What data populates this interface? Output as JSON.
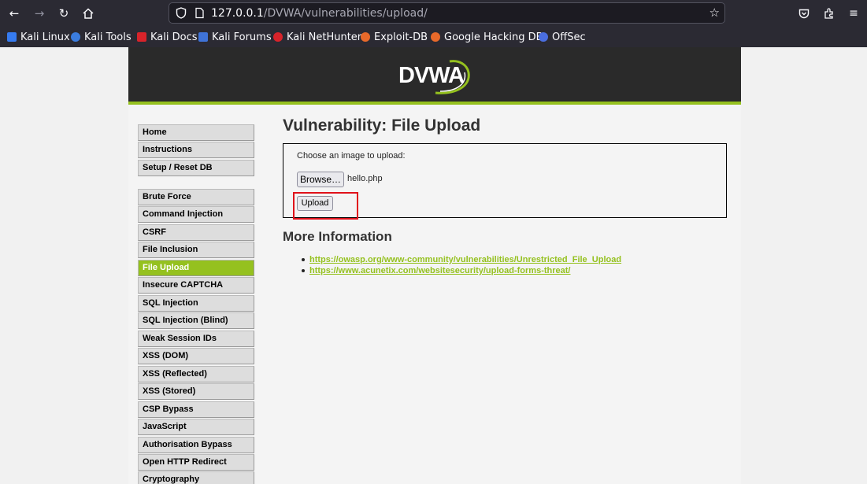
{
  "browser": {
    "url_host": "127.0.0.1",
    "url_path": "/DVWA/vulnerabilities/upload/",
    "bookmarks": [
      {
        "label": "Kali Linux",
        "color": "#367bf0"
      },
      {
        "label": "Kali Tools",
        "color": "#3b7de0"
      },
      {
        "label": "Kali Docs",
        "color": "#d8232a"
      },
      {
        "label": "Kali Forums",
        "color": "#3f73d8"
      },
      {
        "label": "Kali NetHunter",
        "color": "#d8232a"
      },
      {
        "label": "Exploit-DB",
        "color": "#e8692a"
      },
      {
        "label": "Google Hacking DB",
        "color": "#e8692a"
      },
      {
        "label": "OffSec",
        "color": "#4a6ee0"
      }
    ]
  },
  "dvwa": {
    "logo": "DVWA",
    "menu": {
      "top": [
        "Home",
        "Instructions",
        "Setup / Reset DB"
      ],
      "vulns": [
        "Brute Force",
        "Command Injection",
        "CSRF",
        "File Inclusion",
        "File Upload",
        "Insecure CAPTCHA",
        "SQL Injection",
        "SQL Injection (Blind)",
        "Weak Session IDs",
        "XSS (DOM)",
        "XSS (Reflected)",
        "XSS (Stored)",
        "CSP Bypass",
        "JavaScript",
        "Authorisation Bypass",
        "Open HTTP Redirect",
        "Cryptography"
      ],
      "selected": "File Upload"
    },
    "title": "Vulnerability: File Upload",
    "upload": {
      "choose_label": "Choose an image to upload:",
      "browse_label": "Browse…",
      "filename": "hello.php",
      "upload_label": "Upload"
    },
    "more_info_heading": "More Information",
    "links": [
      "https://owasp.org/www-community/vulnerabilities/Unrestricted_File_Upload",
      "https://www.acunetix.com/websitesecurity/upload-forms-threat/"
    ]
  },
  "colors": {
    "accent": "#95c11f",
    "highlight": "#e0111a",
    "header_bg": "#2a2a2a"
  }
}
